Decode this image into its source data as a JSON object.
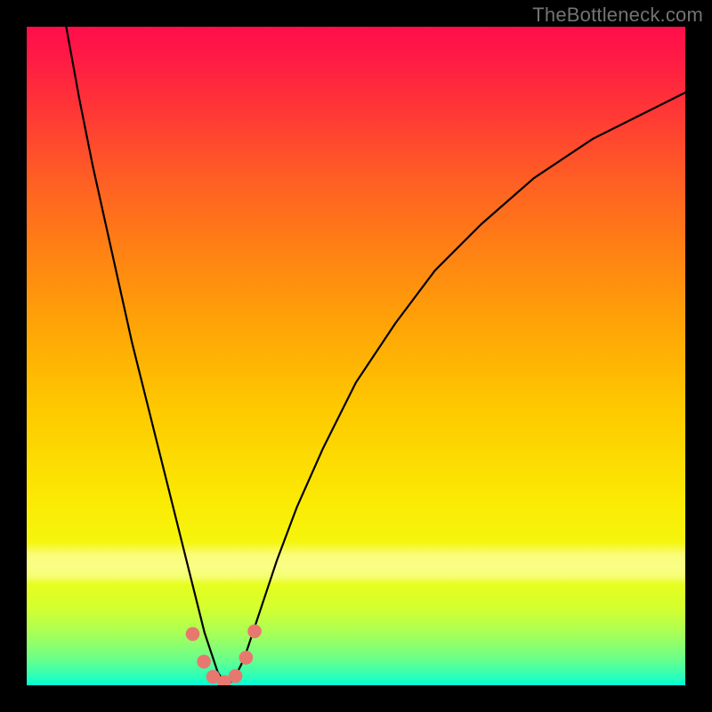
{
  "attribution": "TheBottleneck.com",
  "chart_data": {
    "type": "line",
    "title": "",
    "xlabel": "",
    "ylabel": "",
    "xlim": [
      0,
      100
    ],
    "ylim": [
      0,
      100
    ],
    "series": [
      {
        "name": "bottleneck-curve",
        "x": [
          6,
          8,
          10,
          12,
          14,
          16,
          18,
          20,
          22,
          24,
          25,
          26,
          27,
          28,
          29,
          30,
          31,
          32,
          33,
          34,
          36,
          38,
          41,
          45,
          50,
          56,
          62,
          69,
          77,
          86,
          96,
          100
        ],
        "y": [
          100,
          89,
          79,
          70,
          61,
          52,
          44,
          36,
          28,
          20,
          16,
          12,
          8,
          5,
          2,
          0.5,
          0.5,
          2,
          4,
          7,
          13,
          19,
          27,
          36,
          46,
          55,
          63,
          70,
          77,
          83,
          88,
          90
        ]
      }
    ],
    "markers": {
      "name": "highlight-dots",
      "color": "#e8786f",
      "points": [
        {
          "x": 25.2,
          "y": 7.8
        },
        {
          "x": 26.9,
          "y": 3.6
        },
        {
          "x": 28.3,
          "y": 1.3
        },
        {
          "x": 30.0,
          "y": 0.5
        },
        {
          "x": 31.7,
          "y": 1.4
        },
        {
          "x": 33.3,
          "y": 4.2
        },
        {
          "x": 34.6,
          "y": 8.2
        }
      ]
    },
    "gradient_stops": [
      {
        "pos": 0.0,
        "color": "#ff0e4b"
      },
      {
        "pos": 0.22,
        "color": "#ff5a26"
      },
      {
        "pos": 0.45,
        "color": "#ffa307"
      },
      {
        "pos": 0.72,
        "color": "#fbea03"
      },
      {
        "pos": 0.92,
        "color": "#aaff55"
      },
      {
        "pos": 1.0,
        "color": "#00ffd8"
      }
    ]
  }
}
